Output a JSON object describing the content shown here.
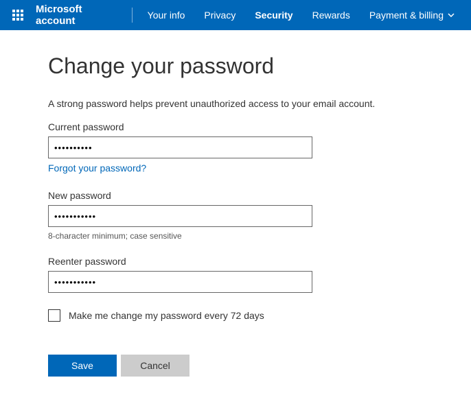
{
  "topbar": {
    "brand": "Microsoft account",
    "nav": {
      "your_info": "Your info",
      "privacy": "Privacy",
      "security": "Security",
      "rewards": "Rewards",
      "payment_billing": "Payment & billing"
    }
  },
  "page": {
    "title": "Change your password",
    "subtitle": "A strong password helps prevent unauthorized access to your email account.",
    "current_password": {
      "label": "Current password",
      "value": "••••••••••",
      "forgot_link": "Forgot your password?"
    },
    "new_password": {
      "label": "New password",
      "value": "•••••••••••",
      "hint": "8-character minimum; case sensitive"
    },
    "reenter_password": {
      "label": "Reenter password",
      "value": "•••••••••••"
    },
    "change_every": {
      "label": "Make me change my password every 72 days",
      "checked": false
    },
    "buttons": {
      "save": "Save",
      "cancel": "Cancel"
    }
  }
}
